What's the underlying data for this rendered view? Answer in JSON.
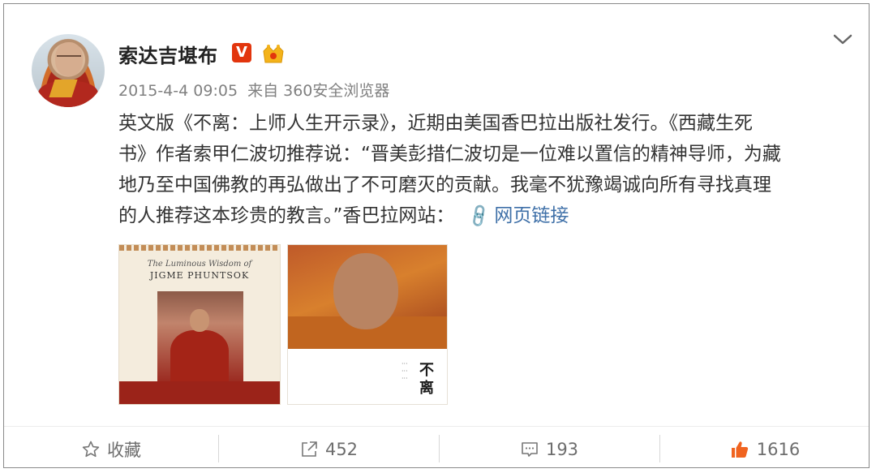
{
  "post": {
    "author": "索达吉堪布",
    "badges": {
      "verified": "V",
      "verified_color": "#e2350d",
      "member_icon": "crown-icon"
    },
    "meta": {
      "time": "2015-4-4 09:05",
      "source": "来自 360安全浏览器"
    },
    "text_lines": [
      "英文版《不离：上师人生开示录》，近期由美国香巴拉出版社发行。《西藏生死",
      "书》作者索甲仁波切推荐说：“晋美彭措仁波切是一位难以置信的精神导师，为藏",
      "地乃至中国佛教的再弘做出了不可磨灭的贡献。我毫不犹豫竭诚向所有寻找真理",
      "的人推荐这本珍贵的教言。”香巴拉网站："
    ],
    "link_text": "网页链接",
    "images": {
      "book_en_title_line1": "The Luminous Wisdom of",
      "book_en_title_line2": "JIGME PHUNTSOK",
      "book_cn_title": "不离"
    }
  },
  "actions": {
    "favorite": "收藏",
    "repost_count": "452",
    "comment_count": "193",
    "like_count": "1616",
    "like_color": "#f0631f"
  }
}
